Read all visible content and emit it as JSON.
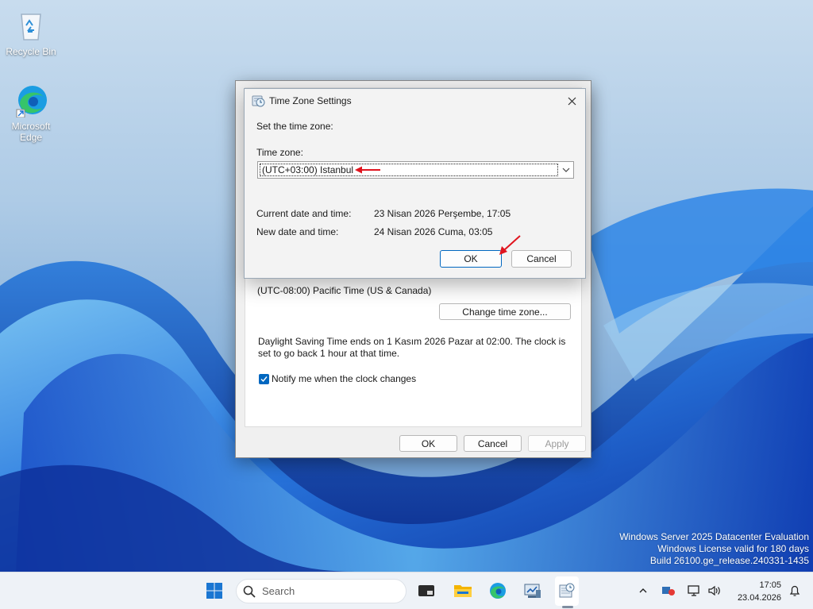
{
  "desktop": {
    "icons": [
      {
        "label": "Recycle Bin"
      },
      {
        "label": "Microsoft Edge"
      }
    ],
    "watermark": {
      "line1": "Windows Server 2025 Datacenter Evaluation",
      "line2": "Windows License valid for 180 days",
      "line3": "Build 26100.ge_release.240331-1435"
    }
  },
  "date_time_dialog": {
    "current_time_zone": "(UTC-08:00) Pacific Time (US & Canada)",
    "change_time_zone_label": "Change time zone...",
    "dst_text": "Daylight Saving Time ends on 1 Kasım 2026 Pazar at 02:00. The clock is set to go back 1 hour at that time.",
    "notify_label": "Notify me when the clock changes",
    "notify_checked": true,
    "ok_label": "OK",
    "cancel_label": "Cancel",
    "apply_label": "Apply"
  },
  "time_zone_dialog": {
    "title": "Time Zone Settings",
    "icon": "clock-globe-icon",
    "prompt": "Set the time zone:",
    "time_zone_label": "Time zone:",
    "selected_time_zone": "(UTC+03:00) Istanbul",
    "current_label": "Current date and time:",
    "current_value": "23 Nisan 2026 Perşembe, 17:05",
    "new_label": "New date and time:",
    "new_value": "24 Nisan 2026 Cuma, 03:05",
    "ok_label": "OK",
    "cancel_label": "Cancel",
    "annotation_color": "#e0141e"
  },
  "taskbar": {
    "search_placeholder": "Search",
    "pinned": [
      "start-icon",
      "search-icon",
      "terminal-icon",
      "file-explorer-icon",
      "edge-icon",
      "server-manager-icon",
      "date-time-control-panel-icon"
    ],
    "tray": [
      "chevron-up-icon",
      "security-icon",
      "network-icon",
      "volume-icon",
      "notifications-icon"
    ],
    "time": "17:05",
    "date": "23.04.2026"
  },
  "colors": {
    "accent": "#0067c0",
    "wallpaper_blue": "#1f5fd1",
    "annotation_red": "#e0141e"
  }
}
